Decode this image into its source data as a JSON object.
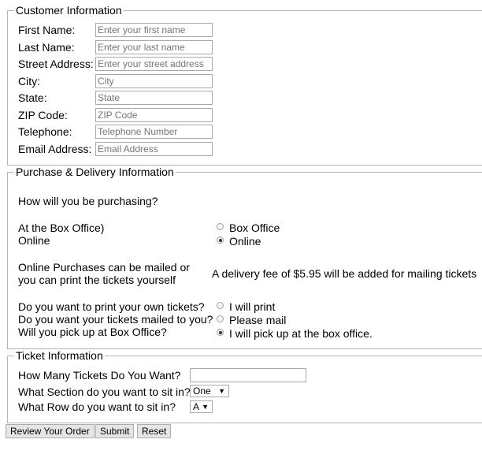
{
  "customer": {
    "legend": "Customer Information",
    "fields": [
      {
        "label": "First Name:",
        "placeholder": "Enter your first name"
      },
      {
        "label": "Last Name:",
        "placeholder": "Enter your last name"
      },
      {
        "label": "Street Address:",
        "placeholder": "Enter your street address"
      },
      {
        "label": "City:",
        "placeholder": "City"
      },
      {
        "label": "State:",
        "placeholder": "State"
      },
      {
        "label": "ZIP Code:",
        "placeholder": "ZIP Code"
      },
      {
        "label": "Telephone:",
        "placeholder": "Telephone Number"
      },
      {
        "label": "Email Address:",
        "placeholder": "Email Address"
      }
    ]
  },
  "purchase": {
    "legend": "Purchase & Delivery Information",
    "question": "How will you be purchasing?",
    "at_box_office": "At the Box Office)",
    "online": "Online",
    "radio_box_office": "Box Office",
    "radio_online": "Online",
    "purchase_selected": "Online",
    "mail_note_1": "Online Purchases can be mailed or",
    "mail_note_2": "you can print the tickets yourself",
    "fee_note": "A delivery fee of $5.95 will be added for mailing tickets",
    "q_print": "Do you want to print your own tickets?",
    "q_mail": "Do you want your tickets mailed to you?",
    "q_pickup": "Will you pick up at Box Office?",
    "opt_print": "I will print",
    "opt_mail": "Please mail",
    "opt_pickup": "I will pick up at the box office.",
    "delivery_selected": "I will pick up at the box office."
  },
  "ticket": {
    "legend": "Ticket Information",
    "q_count": "How Many Tickets Do You Want?",
    "q_section": "What Section do you want to sit in?",
    "q_row": "What Row do you want to sit in?",
    "section_value": "One",
    "row_value": "A"
  },
  "buttons": {
    "review": "Review Your Order",
    "submit": "Submit",
    "reset": "Reset"
  }
}
